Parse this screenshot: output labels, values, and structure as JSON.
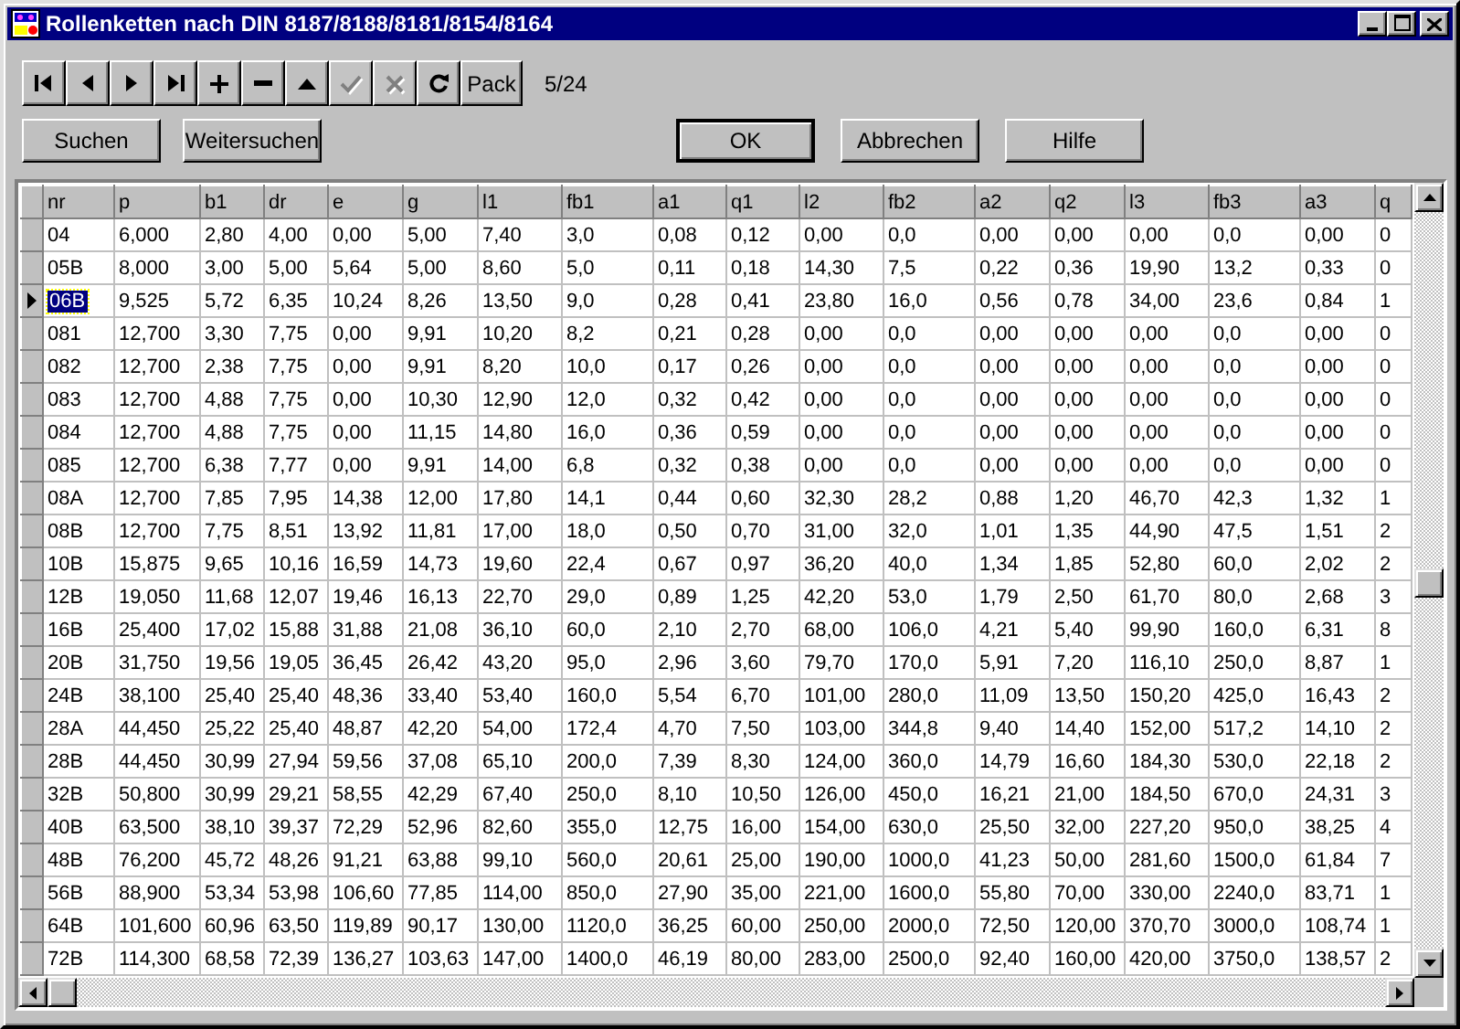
{
  "window": {
    "title": "Rollenketten nach DIN 8187/8188/8181/8154/8164"
  },
  "navigator": {
    "buttons": [
      {
        "kind": "first",
        "disabled": false
      },
      {
        "kind": "prior",
        "disabled": false
      },
      {
        "kind": "next",
        "disabled": false
      },
      {
        "kind": "last",
        "disabled": false
      },
      {
        "kind": "insert",
        "disabled": false
      },
      {
        "kind": "delete",
        "disabled": false
      },
      {
        "kind": "edit",
        "disabled": false
      },
      {
        "kind": "post",
        "disabled": true
      },
      {
        "kind": "cancel",
        "disabled": true
      },
      {
        "kind": "refresh",
        "disabled": false
      },
      {
        "kind": "text",
        "label": "Pack",
        "disabled": false
      }
    ],
    "record_counter": "5/24"
  },
  "buttons": [
    {
      "label": "Suchen",
      "default": false
    },
    {
      "label": "Weitersuchen",
      "default": false
    },
    {
      "label": "OK",
      "default": true
    },
    {
      "label": "Abbrechen",
      "default": false
    },
    {
      "label": "Hilfe",
      "default": false
    }
  ],
  "table": {
    "columns": [
      "nr",
      "p",
      "b1",
      "dr",
      "e",
      "g",
      "l1",
      "fb1",
      "a1",
      "q1",
      "l2",
      "fb2",
      "a2",
      "q2",
      "l3",
      "fb3",
      "a3",
      "q"
    ],
    "rows": [
      {
        "selected": false,
        "cells": [
          "04",
          "6,000",
          "2,80",
          "4,00",
          "0,00",
          "5,00",
          "7,40",
          "3,0",
          "0,08",
          "0,12",
          "0,00",
          "0,0",
          "0,00",
          "0,00",
          "0,00",
          "0,0",
          "0,00",
          "0"
        ]
      },
      {
        "selected": false,
        "cells": [
          "05B",
          "8,000",
          "3,00",
          "5,00",
          "5,64",
          "5,00",
          "8,60",
          "5,0",
          "0,11",
          "0,18",
          "14,30",
          "7,5",
          "0,22",
          "0,36",
          "19,90",
          "13,2",
          "0,33",
          "0"
        ]
      },
      {
        "selected": true,
        "cells": [
          "06B",
          "9,525",
          "5,72",
          "6,35",
          "10,24",
          "8,26",
          "13,50",
          "9,0",
          "0,28",
          "0,41",
          "23,80",
          "16,0",
          "0,56",
          "0,78",
          "34,00",
          "23,6",
          "0,84",
          "1"
        ]
      },
      {
        "selected": false,
        "cells": [
          "081",
          "12,700",
          "3,30",
          "7,75",
          "0,00",
          "9,91",
          "10,20",
          "8,2",
          "0,21",
          "0,28",
          "0,00",
          "0,0",
          "0,00",
          "0,00",
          "0,00",
          "0,0",
          "0,00",
          "0"
        ]
      },
      {
        "selected": false,
        "cells": [
          "082",
          "12,700",
          "2,38",
          "7,75",
          "0,00",
          "9,91",
          "8,20",
          "10,0",
          "0,17",
          "0,26",
          "0,00",
          "0,0",
          "0,00",
          "0,00",
          "0,00",
          "0,0",
          "0,00",
          "0"
        ]
      },
      {
        "selected": false,
        "cells": [
          "083",
          "12,700",
          "4,88",
          "7,75",
          "0,00",
          "10,30",
          "12,90",
          "12,0",
          "0,32",
          "0,42",
          "0,00",
          "0,0",
          "0,00",
          "0,00",
          "0,00",
          "0,0",
          "0,00",
          "0"
        ]
      },
      {
        "selected": false,
        "cells": [
          "084",
          "12,700",
          "4,88",
          "7,75",
          "0,00",
          "11,15",
          "14,80",
          "16,0",
          "0,36",
          "0,59",
          "0,00",
          "0,0",
          "0,00",
          "0,00",
          "0,00",
          "0,0",
          "0,00",
          "0"
        ]
      },
      {
        "selected": false,
        "cells": [
          "085",
          "12,700",
          "6,38",
          "7,77",
          "0,00",
          "9,91",
          "14,00",
          "6,8",
          "0,32",
          "0,38",
          "0,00",
          "0,0",
          "0,00",
          "0,00",
          "0,00",
          "0,0",
          "0,00",
          "0"
        ]
      },
      {
        "selected": false,
        "cells": [
          "08A",
          "12,700",
          "7,85",
          "7,95",
          "14,38",
          "12,00",
          "17,80",
          "14,1",
          "0,44",
          "0,60",
          "32,30",
          "28,2",
          "0,88",
          "1,20",
          "46,70",
          "42,3",
          "1,32",
          "1"
        ]
      },
      {
        "selected": false,
        "cells": [
          "08B",
          "12,700",
          "7,75",
          "8,51",
          "13,92",
          "11,81",
          "17,00",
          "18,0",
          "0,50",
          "0,70",
          "31,00",
          "32,0",
          "1,01",
          "1,35",
          "44,90",
          "47,5",
          "1,51",
          "2"
        ]
      },
      {
        "selected": false,
        "cells": [
          "10B",
          "15,875",
          "9,65",
          "10,16",
          "16,59",
          "14,73",
          "19,60",
          "22,4",
          "0,67",
          "0,97",
          "36,20",
          "40,0",
          "1,34",
          "1,85",
          "52,80",
          "60,0",
          "2,02",
          "2"
        ]
      },
      {
        "selected": false,
        "cells": [
          "12B",
          "19,050",
          "11,68",
          "12,07",
          "19,46",
          "16,13",
          "22,70",
          "29,0",
          "0,89",
          "1,25",
          "42,20",
          "53,0",
          "1,79",
          "2,50",
          "61,70",
          "80,0",
          "2,68",
          "3"
        ]
      },
      {
        "selected": false,
        "cells": [
          "16B",
          "25,400",
          "17,02",
          "15,88",
          "31,88",
          "21,08",
          "36,10",
          "60,0",
          "2,10",
          "2,70",
          "68,00",
          "106,0",
          "4,21",
          "5,40",
          "99,90",
          "160,0",
          "6,31",
          "8"
        ]
      },
      {
        "selected": false,
        "cells": [
          "20B",
          "31,750",
          "19,56",
          "19,05",
          "36,45",
          "26,42",
          "43,20",
          "95,0",
          "2,96",
          "3,60",
          "79,70",
          "170,0",
          "5,91",
          "7,20",
          "116,10",
          "250,0",
          "8,87",
          "1"
        ]
      },
      {
        "selected": false,
        "cells": [
          "24B",
          "38,100",
          "25,40",
          "25,40",
          "48,36",
          "33,40",
          "53,40",
          "160,0",
          "5,54",
          "6,70",
          "101,00",
          "280,0",
          "11,09",
          "13,50",
          "150,20",
          "425,0",
          "16,43",
          "2"
        ]
      },
      {
        "selected": false,
        "cells": [
          "28A",
          "44,450",
          "25,22",
          "25,40",
          "48,87",
          "42,20",
          "54,00",
          "172,4",
          "4,70",
          "7,50",
          "103,00",
          "344,8",
          "9,40",
          "14,40",
          "152,00",
          "517,2",
          "14,10",
          "2"
        ]
      },
      {
        "selected": false,
        "cells": [
          "28B",
          "44,450",
          "30,99",
          "27,94",
          "59,56",
          "37,08",
          "65,10",
          "200,0",
          "7,39",
          "8,30",
          "124,00",
          "360,0",
          "14,79",
          "16,60",
          "184,30",
          "530,0",
          "22,18",
          "2"
        ]
      },
      {
        "selected": false,
        "cells": [
          "32B",
          "50,800",
          "30,99",
          "29,21",
          "58,55",
          "42,29",
          "67,40",
          "250,0",
          "8,10",
          "10,50",
          "126,00",
          "450,0",
          "16,21",
          "21,00",
          "184,50",
          "670,0",
          "24,31",
          "3"
        ]
      },
      {
        "selected": false,
        "cells": [
          "40B",
          "63,500",
          "38,10",
          "39,37",
          "72,29",
          "52,96",
          "82,60",
          "355,0",
          "12,75",
          "16,00",
          "154,00",
          "630,0",
          "25,50",
          "32,00",
          "227,20",
          "950,0",
          "38,25",
          "4"
        ]
      },
      {
        "selected": false,
        "cells": [
          "48B",
          "76,200",
          "45,72",
          "48,26",
          "91,21",
          "63,88",
          "99,10",
          "560,0",
          "20,61",
          "25,00",
          "190,00",
          "1000,0",
          "41,23",
          "50,00",
          "281,60",
          "1500,0",
          "61,84",
          "7"
        ]
      },
      {
        "selected": false,
        "cells": [
          "56B",
          "88,900",
          "53,34",
          "53,98",
          "106,60",
          "77,85",
          "114,00",
          "850,0",
          "27,90",
          "35,00",
          "221,00",
          "1600,0",
          "55,80",
          "70,00",
          "330,00",
          "2240,0",
          "83,71",
          "1"
        ]
      },
      {
        "selected": false,
        "cells": [
          "64B",
          "101,600",
          "60,96",
          "63,50",
          "119,89",
          "90,17",
          "130,00",
          "1120,0",
          "36,25",
          "60,00",
          "250,00",
          "2000,0",
          "72,50",
          "120,00",
          "370,70",
          "3000,0",
          "108,74",
          "1"
        ]
      },
      {
        "selected": false,
        "cells": [
          "72B",
          "114,300",
          "68,58",
          "72,39",
          "136,27",
          "103,63",
          "147,00",
          "1400,0",
          "46,19",
          "80,00",
          "283,00",
          "2500,0",
          "92,40",
          "160,00",
          "420,00",
          "3750,0",
          "138,57",
          "2"
        ]
      }
    ]
  }
}
